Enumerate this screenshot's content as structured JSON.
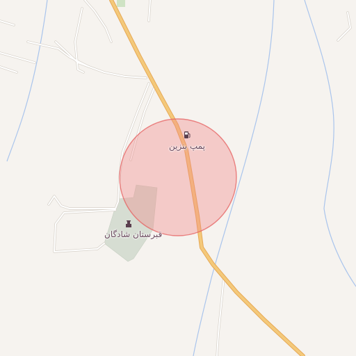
{
  "map": {
    "colors": {
      "background": "#f6f3ef",
      "main_road": "#f4c97a",
      "main_road_casing": "#e6a856",
      "minor_road": "#ffffff",
      "minor_road_casing": "#d6d0c8",
      "water": "#a9c4ec",
      "cemetery": "#d6ddd2",
      "highlight_fill": "#f28a8a",
      "highlight_stroke": "#e65f5f",
      "label": "#6b4a5e"
    },
    "pois": [
      {
        "name": "پمپ بنزین",
        "icon": "fuel-pump-icon"
      },
      {
        "name": "قبرستان شادگان",
        "icon": "cemetery-icon"
      }
    ]
  }
}
